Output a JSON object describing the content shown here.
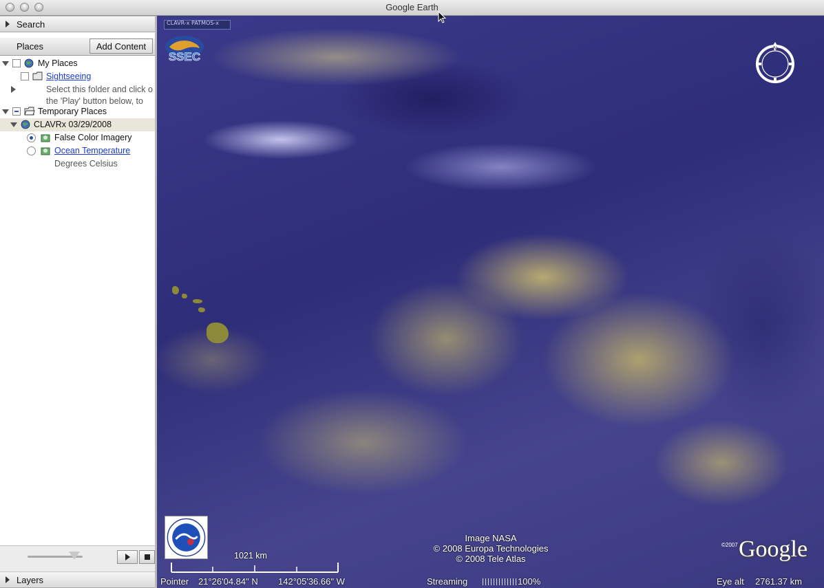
{
  "window": {
    "title": "Google Earth"
  },
  "sidebar": {
    "search_label": "Search",
    "places_tab": "Places",
    "add_content": "Add Content",
    "layers_label": "Layers",
    "tree": {
      "my_places": "My Places",
      "sightseeing": "Sightseeing",
      "sightseeing_desc_1": "Select this folder and click o",
      "sightseeing_desc_2": "the 'Play' button below, to",
      "temporary_places": "Temporary Places",
      "clavrx": "CLAVRx 03/29/2008",
      "false_color": "False Color Imagery",
      "ocean_temp": "Ocean Temperature",
      "ocean_temp_desc": "Degrees Celsius"
    },
    "tour_slider": {
      "value": 0.8
    }
  },
  "map": {
    "badge_top": "CLAVR-x PATMOS-x",
    "logo_text": "SSEC",
    "compass_label": "N",
    "scale_label": "1021 km",
    "attribution": [
      "Image NASA",
      "© 2008 Europa Technologies",
      "© 2008 Tele Atlas"
    ],
    "copyright_small": "©2007",
    "google_logo": "Google"
  },
  "status": {
    "pointer_label": "Pointer",
    "pointer_lat": "21°26'04.84\" N",
    "pointer_lon": "142°05'36.66\" W",
    "streaming_label": "Streaming",
    "streaming_value": "100%",
    "eye_alt_label": "Eye alt",
    "eye_alt_value": "2761.37 km"
  },
  "colors": {
    "ocean": "#2e2d78",
    "cloud": "#c8b96a",
    "link": "#1a3ccf",
    "selected_row": "#e8e7d9"
  }
}
